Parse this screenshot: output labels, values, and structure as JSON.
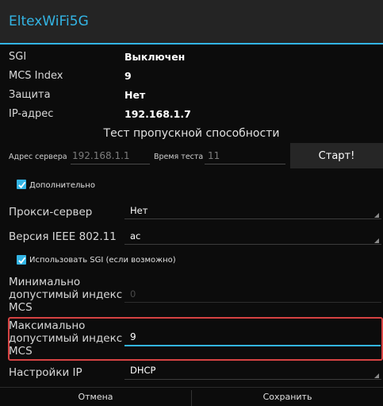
{
  "app": {
    "title": "EltexWiFi5G"
  },
  "info": [
    {
      "label": "SGI",
      "value": "Выключен"
    },
    {
      "label": "MCS Index",
      "value": "9"
    },
    {
      "label": "Защита",
      "value": "Нет"
    },
    {
      "label": "IP-адрес",
      "value": "192.168.1.7"
    }
  ],
  "throughput": {
    "title": "Тест пропускной способности",
    "server_label": "Адрес сервера",
    "server_value": "192.168.1.1",
    "time_label": "Время теста",
    "time_value": "11",
    "start_label": "Старт!"
  },
  "advanced": {
    "checkbox_label": "Дополнительно",
    "checked": true
  },
  "proxy": {
    "label": "Прокси-сервер",
    "value": "Нет"
  },
  "ieee": {
    "label": "Версия IEEE 802.11",
    "value": "ac"
  },
  "sgi_option": {
    "label": "Использовать SGI (если возможно)",
    "checked": true
  },
  "min_mcs": {
    "label_lines": [
      "Минимально",
      "допустимый индекс",
      "MCS"
    ],
    "value": "0"
  },
  "max_mcs": {
    "label_lines": [
      "Максимально",
      "допустимый индекс",
      "MCS"
    ],
    "value": "9"
  },
  "ip_settings": {
    "label": "Настройки IP",
    "value": "DHCP"
  },
  "actions": {
    "cancel_label": "Отмена",
    "save_label": "Сохранить"
  },
  "colors": {
    "accent": "#33b5e5",
    "highlight": "#d64343",
    "background": "#0c0c0c"
  }
}
